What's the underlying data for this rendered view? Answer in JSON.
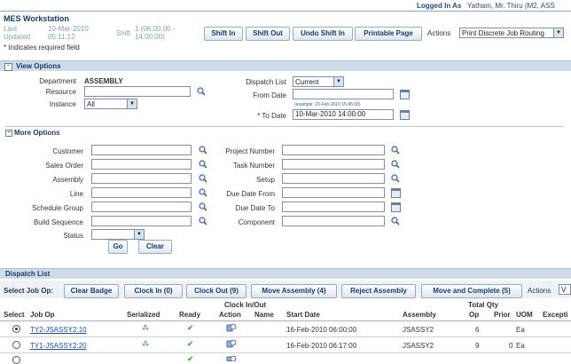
{
  "header": {
    "logged_in_label": "Logged In As",
    "user": "Yatham, Mr. Thiru (M2, ASS",
    "title": "MES Workstation",
    "last_updated_label": "Last Updated",
    "last_updated_value": "10-Mar-2010 05:11:12",
    "shift_label": "Shift",
    "shift_value": "1 (06:00:00 - 14:00:00)",
    "required_note": "* Indicates required field"
  },
  "toolbar": {
    "shift_in": "Shift In",
    "shift_out": "Shift Out",
    "undo_shift_in": "Undo Shift In",
    "printable_page": "Printable Page",
    "actions_label": "Actions",
    "actions_value": "Print Discrete Job Routing"
  },
  "view_options": {
    "section_title": "View Options",
    "department_label": "Department",
    "department_value": "ASSEMBLY",
    "resource_label": "Resource",
    "instance_label": "Instance",
    "instance_value": "All",
    "dispatch_list_label": "Dispatch List",
    "dispatch_list_value": "Current",
    "from_date_label": "From Date",
    "from_date_hint": "(example: 23-Feb-2010 15:45:00)",
    "to_date_label": "* To Date",
    "to_date_value": "10-Mar-2010 14:00:00"
  },
  "more_options": {
    "title": "More Options",
    "customer": "Customer",
    "sales_order": "Sales Order",
    "assembly": "Assembly",
    "line": "Line",
    "schedule_group": "Schedule Group",
    "build_sequence": "Build Sequence",
    "status": "Status",
    "project_number": "Project Number",
    "task_number": "Task Number",
    "setup": "Setup",
    "due_date_from": "Due Date From",
    "due_date_to": "Due Date To",
    "component": "Component",
    "go": "Go",
    "clear": "Clear"
  },
  "dispatch_list": {
    "section_title": "Dispatch List",
    "select_job_op_label": "Select Job Op:",
    "clear_badge": "Clear Badge",
    "clock_in": "Clock In (0)",
    "clock_out": "Clock Out (9)",
    "move_assembly": "Move Assembly (4)",
    "reject_assembly": "Reject Assembly",
    "move_and_complete": "Move and Complete (5)",
    "actions_label": "Actions",
    "actions_value": "V",
    "columns": {
      "select": "Select",
      "job_op": "Job Op",
      "serialized": "Serialized",
      "ready": "Ready",
      "clock_group": "Clock In/Out",
      "action": "Action",
      "name": "Name",
      "start_date": "Start Date",
      "assembly": "Assembly",
      "total_qty": "Total Qty",
      "op": "Op",
      "prior": "Prior",
      "uom": "UOM",
      "exceptions": "Excepti"
    },
    "rows": [
      {
        "job_op": "TY2-JSASSY2:10",
        "start_date": "16-Feb-2010 06:00:00",
        "assembly": "JSASSY2",
        "op": "6",
        "prior": "",
        "uom": "Ea"
      },
      {
        "job_op": "TY1-JSASSY2:20",
        "start_date": "16-Feb-2010 06:17:00",
        "assembly": "JSASSY2",
        "op": "9",
        "prior": "0",
        "uom": "Ea"
      }
    ]
  }
}
